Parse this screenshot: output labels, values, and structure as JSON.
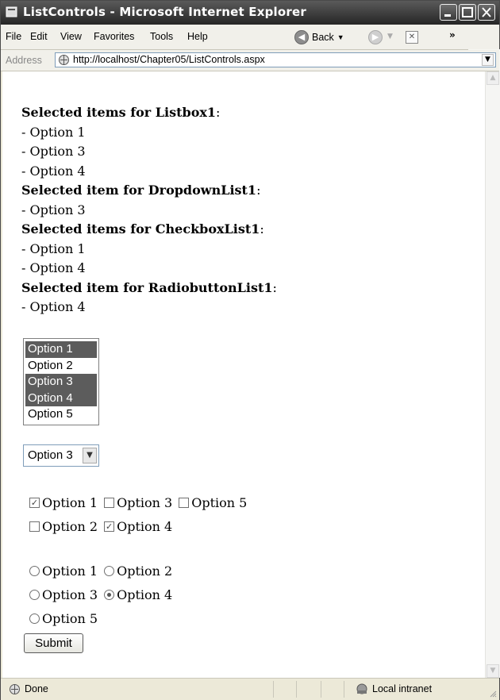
{
  "window": {
    "title": "ListControls - Microsoft Internet Explorer"
  },
  "menu": {
    "file": "File",
    "edit": "Edit",
    "view": "View",
    "favorites": "Favorites",
    "tools": "Tools",
    "help": "Help",
    "back": "Back",
    "more": "»"
  },
  "address": {
    "label": "Address",
    "url": "http://localhost/Chapter05/ListControls.aspx"
  },
  "results": {
    "h_listbox_bold": "Selected items for Listbox1",
    "h_listbox_colon": ":",
    "listbox_items": [
      "- Option 1",
      "- Option 3",
      "- Option 4"
    ],
    "h_dropdown_bold": "Selected item for DropdownList1",
    "h_dropdown_colon": ":",
    "dropdown_items": [
      "- Option 3"
    ],
    "h_checkbox_bold": "Selected items for CheckboxList1",
    "h_checkbox_colon": ":",
    "checkbox_items": [
      "- Option 1",
      "- Option 4"
    ],
    "h_radio_bold": "Selected item for RadiobuttonList1",
    "h_radio_colon": ":",
    "radio_items": [
      "- Option 4"
    ]
  },
  "listbox": {
    "options": [
      {
        "label": "Option 1",
        "selected": true
      },
      {
        "label": "Option 2",
        "selected": false
      },
      {
        "label": "Option 3",
        "selected": true
      },
      {
        "label": "Option 4",
        "selected": true
      },
      {
        "label": "Option 5",
        "selected": false
      }
    ]
  },
  "dropdown": {
    "selected": "Option 3"
  },
  "checkboxlist": {
    "rows": [
      [
        {
          "label": "Option 1",
          "checked": true
        },
        {
          "label": "Option 3",
          "checked": false
        },
        {
          "label": "Option 5",
          "checked": false
        }
      ],
      [
        {
          "label": "Option 2",
          "checked": false
        },
        {
          "label": "Option 4",
          "checked": true
        }
      ]
    ]
  },
  "radiolist": {
    "rows": [
      [
        {
          "label": "Option 1",
          "checked": false
        },
        {
          "label": "Option 2",
          "checked": false
        }
      ],
      [
        {
          "label": "Option 3",
          "checked": false
        },
        {
          "label": "Option 4",
          "checked": true
        }
      ],
      [
        {
          "label": "Option 5",
          "checked": false
        }
      ]
    ]
  },
  "submit_label": "Submit",
  "status": {
    "text": "Done",
    "zone": "Local intranet"
  }
}
